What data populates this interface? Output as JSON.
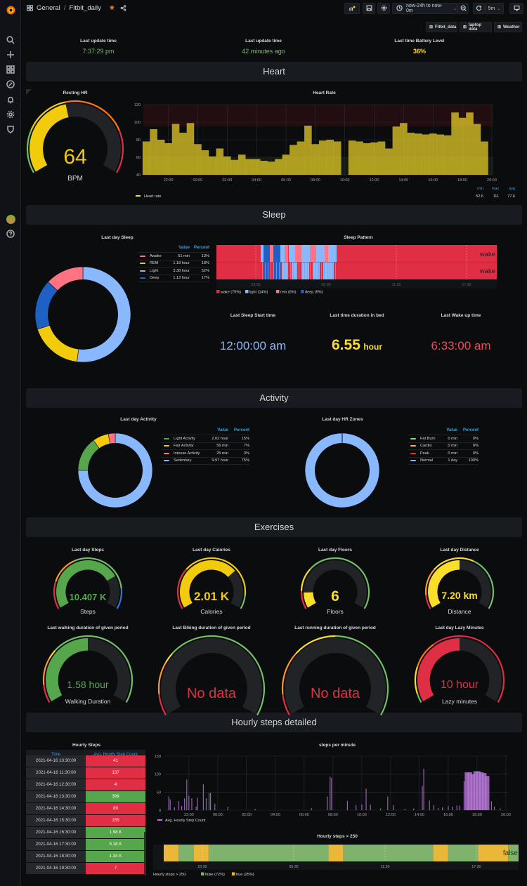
{
  "breadcrumb": {
    "folder": "General",
    "separator": "/",
    "dashboard": "Fitbit_daily"
  },
  "toolbar": {
    "time_range": "now-24h to now-0m",
    "refresh_interval": "5m",
    "icons": [
      "add-panel-icon",
      "save-icon",
      "settings-icon",
      "clock-icon",
      "zoom-out-icon",
      "refresh-icon",
      "tv-mode-icon"
    ]
  },
  "dashboard_links": [
    {
      "label": "Fitbit_data",
      "icon": "dashboard-icon"
    },
    {
      "label": "laptop data",
      "icon": "dashboard-icon"
    },
    {
      "label": "Weather",
      "icon": "dashboard-icon"
    }
  ],
  "sidebar": {
    "items": [
      {
        "name": "search",
        "icon": "search-icon"
      },
      {
        "name": "create",
        "icon": "plus-icon"
      },
      {
        "name": "dashboards",
        "icon": "dashboards-icon"
      },
      {
        "name": "explore",
        "icon": "compass-icon"
      },
      {
        "name": "alerting",
        "icon": "bell-icon"
      },
      {
        "name": "configuration",
        "icon": "gear-icon"
      },
      {
        "name": "server-admin",
        "icon": "shield-icon"
      }
    ],
    "bottom": [
      {
        "name": "profile",
        "icon": "avatar"
      },
      {
        "name": "help",
        "icon": "help-icon"
      }
    ]
  },
  "top_stats": [
    {
      "label": "Last update time",
      "value": "7:37:29 pm",
      "color": "#73bf69"
    },
    {
      "label": "Last update time",
      "value": "42 minutes ago",
      "color": "#73bf69"
    },
    {
      "label": "Last time Battery Level",
      "value": "36%",
      "color": "#fade2a"
    }
  ],
  "rows": {
    "heart": "Heart",
    "sleep": "Sleep",
    "activity": "Activity",
    "exercises": "Exercises",
    "hourly": "Hourly steps detailed"
  },
  "resting_hr": {
    "title": "Resting HR",
    "value": "64",
    "unit": "BPM",
    "fraction": 0.45,
    "color": "#f2cc0c"
  },
  "heart_rate_chart": {
    "title": "Heart Rate",
    "chart_data": {
      "type": "area",
      "title": "Heart Rate",
      "ylim": [
        40,
        120
      ],
      "yticks": [
        "40",
        "60",
        "80",
        "100",
        "120"
      ],
      "xticks": [
        "22:00",
        "00:00",
        "02:00",
        "04:00",
        "06:00",
        "08:00",
        "10:00",
        "12:00",
        "14:00",
        "16:00",
        "18:00",
        "20:00"
      ],
      "x_hours": [
        20.5,
        21.0,
        21.5,
        22.0,
        22.5,
        23.0,
        23.5,
        0.0,
        0.5,
        1.0,
        1.5,
        2.0,
        2.5,
        3.0,
        3.5,
        4.0,
        4.5,
        5.0,
        5.5,
        6.0,
        6.5,
        7.0,
        7.5,
        8.0,
        8.5,
        9.0,
        9.5,
        10.0,
        10.5,
        11.0,
        11.5,
        12.0,
        12.5,
        13.0,
        13.5,
        14.0,
        14.5,
        15.0,
        15.5,
        16.0,
        16.5,
        17.0,
        17.5,
        18.0,
        18.5,
        19.0,
        19.5
      ],
      "series": [
        {
          "name": "Heart rate",
          "color": "#fade2a",
          "values": [
            78,
            92,
            80,
            76,
            98,
            88,
            99,
            75,
            68,
            61,
            70,
            61,
            57,
            63,
            58,
            58,
            56,
            55,
            58,
            63,
            74,
            78,
            96,
            75,
            79,
            80,
            78,
            0,
            79,
            78,
            76,
            77,
            78,
            70,
            95,
            99,
            88,
            87,
            86,
            87,
            86,
            85,
            111,
            105,
            111,
            98,
            78
          ]
        }
      ],
      "threshold_bands": [
        {
          "from": 95,
          "to": 120,
          "color": "#c4162a"
        },
        {
          "from": 40,
          "to": 60,
          "color": "#37872d"
        }
      ],
      "legend": {
        "min_label": "min",
        "max_label": "max",
        "avg_label": "avg",
        "min": "52.6",
        "max": "111",
        "avg": "77.6"
      }
    }
  },
  "last_day_sleep": {
    "title": "Last day Sleep",
    "headers": {
      "value": "Value",
      "percent": "Percent"
    },
    "chart_data": {
      "type": "pie",
      "donut": true,
      "slices": [
        {
          "name": "Awake",
          "value": "51 min",
          "percent": 13,
          "color": "#ff7383"
        },
        {
          "name": "REM",
          "value": "1.18 hour",
          "percent": 18,
          "color": "#f2cc0c"
        },
        {
          "name": "Light",
          "value": "3.38 hour",
          "percent": 52,
          "color": "#8ab8ff"
        },
        {
          "name": "Deep",
          "value": "1.13 hour",
          "percent": 17,
          "color": "#1f60c4"
        }
      ]
    }
  },
  "sleep_pattern": {
    "title": "Sleep Pattern",
    "row_label": "wake",
    "xticks": [
      "23:30",
      "05:30",
      "11:30",
      "17:30"
    ],
    "legend": [
      {
        "label": "wake (75%)",
        "color": "#e02f44"
      },
      {
        "label": "light (14%)",
        "color": "#8ab8ff"
      },
      {
        "label": "rem (6%)",
        "color": "#ff7383"
      },
      {
        "label": "deep (5%)",
        "color": "#1f60c4"
      }
    ]
  },
  "sleep_stats": [
    {
      "label": "Last Sleep Start time",
      "value": "12:00:00 am",
      "unit": "",
      "color": "#8ab8ff"
    },
    {
      "label": "Last time duration in bed",
      "value": "6.55",
      "unit": "hour",
      "color": "#fade2a"
    },
    {
      "label": "Last Wake up time",
      "value": "6:33:00 am",
      "unit": "",
      "color": "#f2495c"
    }
  ],
  "last_day_activity": {
    "title": "Last day Activity",
    "headers": {
      "value": "Value",
      "percent": "Percent"
    },
    "chart_data": {
      "type": "pie",
      "donut": true,
      "slices": [
        {
          "name": "Light Activity",
          "value": "2.02 hour",
          "percent": 15,
          "color": "#56a64b"
        },
        {
          "name": "Fair Activity",
          "value": "56 min",
          "percent": 7,
          "color": "#f2cc0c"
        },
        {
          "name": "Intense Activity",
          "value": "25 min",
          "percent": 3,
          "color": "#ff7383"
        },
        {
          "name": "Sedentary",
          "value": "9.97 hour",
          "percent": 75,
          "color": "#8ab8ff"
        }
      ]
    }
  },
  "last_day_hr_zones": {
    "title": "Last day HR Zones",
    "headers": {
      "value": "Value",
      "percent": "Percent"
    },
    "chart_data": {
      "type": "pie",
      "donut": true,
      "slices": [
        {
          "name": "Fat Burn",
          "value": "0 min",
          "percent": 0,
          "color": "#96d98d"
        },
        {
          "name": "Cardio",
          "value": "0 min",
          "percent": 0,
          "color": "#ffb357"
        },
        {
          "name": "Peak",
          "value": "0 min",
          "percent": 0,
          "color": "#e02f44"
        },
        {
          "name": "Normal",
          "value": "1 day",
          "percent": 100,
          "color": "#8ab8ff"
        }
      ]
    }
  },
  "gauges": [
    {
      "title": "Last day Steps",
      "value": "10.407 K",
      "label": "Steps",
      "fraction": 0.75,
      "color": "#56a64b"
    },
    {
      "title": "Last day Calories",
      "value": "2.01 K",
      "label": "Calories",
      "fraction": 0.7,
      "color": "#f2cc0c"
    },
    {
      "title": "Last day Floors",
      "value": "6",
      "label": "Floors",
      "fraction": 0.12,
      "color": "#fade2a"
    },
    {
      "title": "Last day Distance",
      "value": "7.20 km",
      "label": "Distance",
      "fraction": 0.5,
      "color": "#fade2a"
    },
    {
      "title": "Last walking duration of given period",
      "value": "1.58 hour",
      "label": "Walking Duration",
      "fraction": 0.5,
      "color": "#56a64b"
    },
    {
      "title": "Last Biking duration of given period",
      "value": "No data",
      "label": "",
      "fraction": 0,
      "color": "#e02f44"
    },
    {
      "title": "Last running duration of given period",
      "value": "No data",
      "label": "",
      "fraction": 0,
      "color": "#e02f44"
    },
    {
      "title": "Last day Lazy Minutes",
      "value": "10 hour",
      "label": "Lazy minutes",
      "fraction": 0.5,
      "color": "#e02f44"
    }
  ],
  "hourly_steps_table": {
    "title": "Hourly Steps",
    "columns": [
      "Time",
      "Avg. Hourly Step Count"
    ],
    "rows": [
      {
        "time": "2021-04-16 10:30:00",
        "value": "41",
        "status": "low"
      },
      {
        "time": "2021-04-16 11:30:00",
        "value": "137",
        "status": "low"
      },
      {
        "time": "2021-04-16 12:30:00",
        "value": "4",
        "status": "low"
      },
      {
        "time": "2021-04-16 13:30:00",
        "value": "396",
        "status": "high"
      },
      {
        "time": "2021-04-16 14:30:00",
        "value": "89",
        "status": "low"
      },
      {
        "time": "2021-04-16 15:30:00",
        "value": "155",
        "status": "low"
      },
      {
        "time": "2021-04-16 16:30:00",
        "value": "1.98 K",
        "status": "high"
      },
      {
        "time": "2021-04-16 17:30:00",
        "value": "5.18 K",
        "status": "high"
      },
      {
        "time": "2021-04-16 18:30:00",
        "value": "1.34 K",
        "status": "high"
      },
      {
        "time": "2021-04-16 19:30:00",
        "value": "7",
        "status": "low"
      }
    ],
    "colors": {
      "low": "#e02f44",
      "high": "#56a64b"
    }
  },
  "steps_per_minute": {
    "title": "steps per minute",
    "chart_data": {
      "type": "bar",
      "title": "steps per minute",
      "ylim": [
        0,
        150
      ],
      "yticks": [
        "0",
        "50",
        "100",
        "150"
      ],
      "xticks": [
        "22:00",
        "00:00",
        "02:00",
        "04:00",
        "06:00",
        "08:00",
        "10:00",
        "12:00",
        "14:00",
        "16:00",
        "18:00",
        "20:00"
      ],
      "series": [
        {
          "name": "Avg. Hourly Step Count",
          "color": "#b877d9",
          "points": [
            [
              20.6,
              38
            ],
            [
              20.7,
              30
            ],
            [
              21.0,
              8
            ],
            [
              21.3,
              25
            ],
            [
              21.5,
              12
            ],
            [
              21.7,
              33
            ],
            [
              21.85,
              85
            ],
            [
              22.0,
              40
            ],
            [
              22.2,
              33
            ],
            [
              22.5,
              10
            ],
            [
              22.6,
              35
            ],
            [
              23.0,
              72
            ],
            [
              23.2,
              33
            ],
            [
              23.4,
              48
            ],
            [
              23.5,
              48
            ],
            [
              23.8,
              18
            ],
            [
              0.7,
              10
            ],
            [
              2.6,
              4
            ],
            [
              6.5,
              6
            ],
            [
              7.6,
              38
            ],
            [
              7.8,
              93
            ],
            [
              7.9,
              90
            ],
            [
              9.0,
              26
            ],
            [
              9.6,
              14
            ],
            [
              10.0,
              16
            ],
            [
              10.3,
              60
            ],
            [
              10.6,
              15
            ],
            [
              11.3,
              5
            ],
            [
              11.8,
              38
            ],
            [
              12.2,
              14
            ],
            [
              13.0,
              4
            ],
            [
              13.6,
              5
            ],
            [
              14.2,
              67
            ],
            [
              14.3,
              115
            ],
            [
              14.7,
              27
            ],
            [
              15.0,
              14
            ],
            [
              15.3,
              6
            ],
            [
              15.6,
              8
            ],
            [
              16.0,
              12
            ],
            [
              16.3,
              10
            ],
            [
              16.6,
              13
            ],
            [
              16.8,
              13
            ],
            [
              17.1,
              80
            ],
            [
              17.3,
              105
            ],
            [
              17.5,
              105
            ],
            [
              17.7,
              100
            ],
            [
              17.9,
              108
            ],
            [
              18.1,
              108
            ],
            [
              18.3,
              105
            ],
            [
              18.5,
              103
            ],
            [
              18.7,
              95
            ],
            [
              19.0,
              25
            ],
            [
              19.2,
              10
            ],
            [
              19.6,
              5
            ]
          ]
        }
      ]
    }
  },
  "hourly_steps_state": {
    "title": "Hourly steps > 250",
    "row_label": "false",
    "xticks": [
      "23:30",
      "05:30",
      "11:30",
      "17:30"
    ],
    "legend_prefix": "Hourly steps > 250:",
    "legend": [
      {
        "label": "false (72%)",
        "color": "#7eb26d"
      },
      {
        "label": "true (25%)",
        "color": "#eab839"
      }
    ],
    "segments": [
      {
        "state": "true",
        "from": 20.5,
        "to": 21.5
      },
      {
        "state": "false",
        "from": 21.5,
        "to": 22.5
      },
      {
        "state": "true",
        "from": 22.5,
        "to": 23.5
      },
      {
        "state": "false",
        "from": 23.5,
        "to": 7.5
      },
      {
        "state": "true",
        "from": 7.5,
        "to": 8.5
      },
      {
        "state": "false",
        "from": 8.5,
        "to": 14.5
      },
      {
        "state": "true",
        "from": 14.5,
        "to": 15.5
      },
      {
        "state": "false",
        "from": 15.5,
        "to": 17.5
      },
      {
        "state": "true",
        "from": 17.5,
        "to": 19.5
      },
      {
        "state": "false",
        "from": 19.5,
        "to": 20.0
      }
    ]
  }
}
